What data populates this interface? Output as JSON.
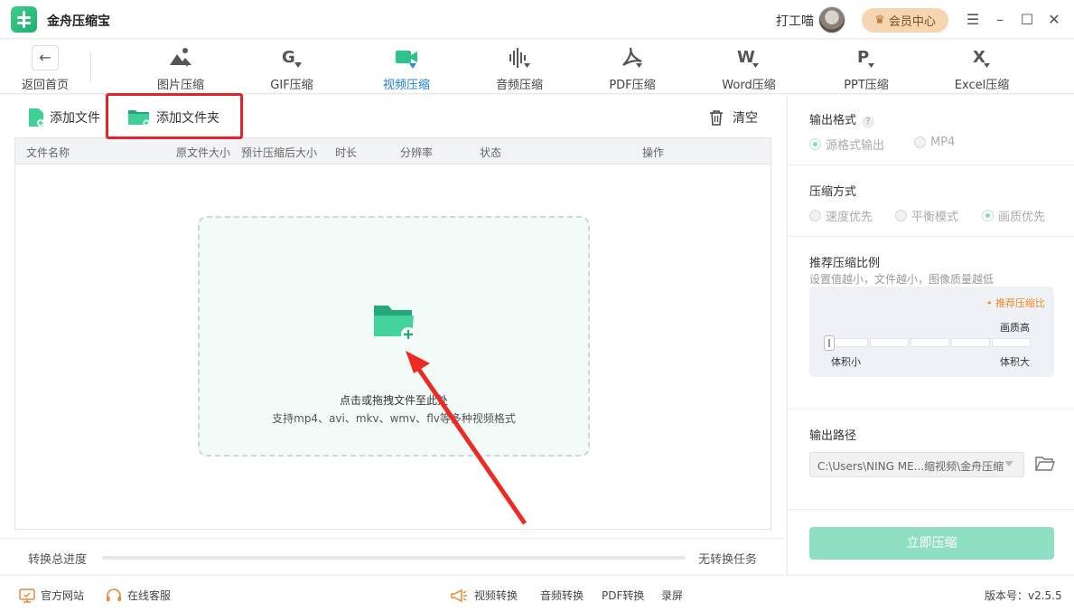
{
  "app": {
    "title": "金舟压缩宝",
    "username": "打工喵",
    "vip_label": "会员中心"
  },
  "window_controls": {
    "menu": "☰",
    "minimize": "–",
    "maximize": "☐",
    "close": "✕"
  },
  "toolbar": {
    "back_label": "返回首页",
    "tools": [
      {
        "label": "图片压缩",
        "icon": "image-icon"
      },
      {
        "label": "GIF压缩",
        "icon": "gif-icon"
      },
      {
        "label": "视频压缩",
        "icon": "video-icon",
        "active": true
      },
      {
        "label": "音频压缩",
        "icon": "audio-icon"
      },
      {
        "label": "PDF压缩",
        "icon": "pdf-icon"
      },
      {
        "label": "Word压缩",
        "icon": "word-icon"
      },
      {
        "label": "PPT压缩",
        "icon": "ppt-icon"
      },
      {
        "label": "Excel压缩",
        "icon": "excel-icon"
      }
    ]
  },
  "actions": {
    "add_file": "添加文件",
    "add_folder": "添加文件夹",
    "clear": "清空"
  },
  "table": {
    "columns": [
      "文件名称",
      "原文件大小",
      "预计压缩后大小",
      "时长",
      "分辨率",
      "状态",
      "操作"
    ]
  },
  "dropzone": {
    "title": "点击或拖拽文件至此处",
    "subtitle": "支持mp4、avi、mkv、wmv、flv等多种视频格式"
  },
  "progress": {
    "label": "转换总进度",
    "value": 0,
    "status": "无转换任务"
  },
  "settings": {
    "output_format": {
      "title": "输出格式",
      "help": "?",
      "options": [
        "源格式输出",
        "MP4"
      ],
      "selected": "源格式输出"
    },
    "compress_mode": {
      "title": "压缩方式",
      "options": [
        "速度优先",
        "平衡模式",
        "画质优先"
      ],
      "selected": "画质优先"
    },
    "ratio": {
      "title": "推荐压缩比例",
      "hint": "设置值越小，文件越小，图像质量越低",
      "recommend_label": "• 推荐压缩比",
      "quality_high": "画质高",
      "volume_small": "体积小",
      "volume_big": "体积大",
      "level": 0
    },
    "output_path": {
      "title": "输出路径",
      "value": "C:\\Users\\NING ME...缩视频\\金舟压缩"
    },
    "compress_button": "立即压缩"
  },
  "footer": {
    "website": "官方网站",
    "support": "在线客服",
    "links": [
      "视频转换",
      "音频转换",
      "PDF转换",
      "录屏"
    ],
    "version": "版本号：v2.5.5"
  },
  "colors": {
    "accent": "#33c48d",
    "active_tab": "#1e7fd6",
    "highlight": "#e8222a",
    "vip_bg": "#f5d6b0"
  }
}
